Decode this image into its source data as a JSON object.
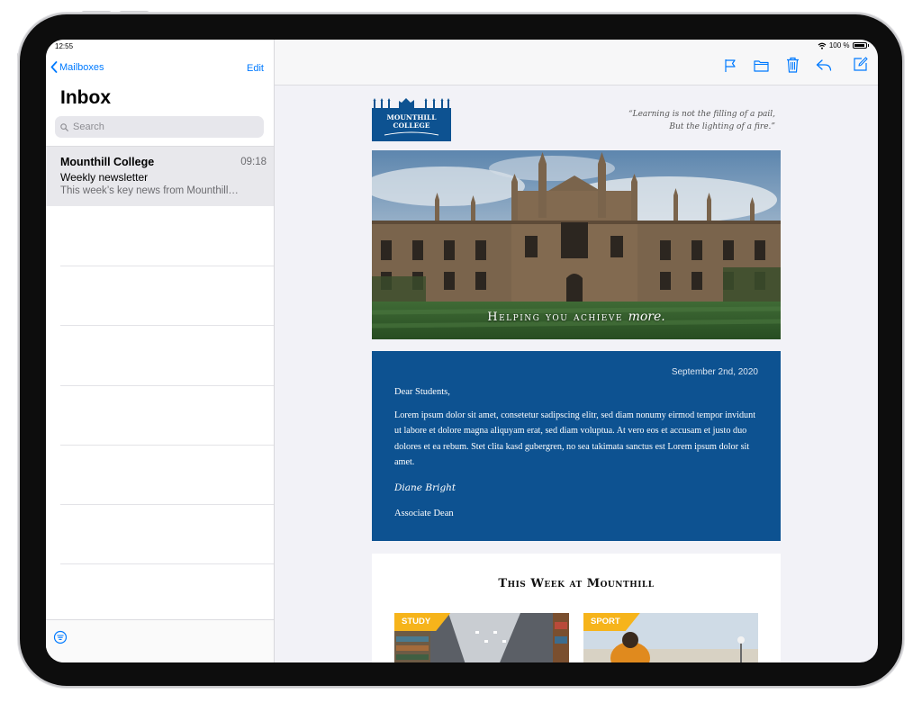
{
  "status_bar": {
    "time": "12:55",
    "battery": "100 %"
  },
  "sidebar": {
    "back_label": "Mailboxes",
    "edit_label": "Edit",
    "title": "Inbox",
    "search_placeholder": "Search",
    "messages": [
      {
        "sender": "Mounthill College",
        "time": "09:18",
        "subject": "Weekly newsletter",
        "preview": "This week’s key news from Mounthill…"
      }
    ]
  },
  "toolbar": {
    "icons": [
      "flag-icon",
      "folder-icon",
      "trash-icon",
      "reply-icon",
      "compose-icon"
    ],
    "accent": "#007aff"
  },
  "email": {
    "logo": {
      "line1": "MOUNTHILL",
      "line2": "COLLEGE"
    },
    "quote": {
      "line1": "“Learning is not the filling of a pail,",
      "line2": "But the lighting of a fire.”"
    },
    "hero": {
      "caption_main": "Helping you achieve",
      "caption_em": "more."
    },
    "letter": {
      "date": "September 2nd, 2020",
      "greeting": "Dear Students,",
      "body": "Lorem ipsum dolor sit amet, consetetur sadipscing elitr, sed diam nonumy eirmod tempor invidunt ut labore et dolore magna aliquyam erat, sed diam voluptua. At vero eos et accusam et justo duo dolores et ea rebum. Stet clita kasd gubergren, no sea takimata sanctus est Lorem ipsum dolor sit amet.",
      "signature": "Diane Bright",
      "role": "Associate Dean"
    },
    "week": {
      "title": "This Week at Mounthill",
      "cards": [
        {
          "tag": "STUDY"
        },
        {
          "tag": "SPORT"
        }
      ]
    }
  },
  "colors": {
    "brand_blue": "#0d5291",
    "tag_yellow": "#f6b41b",
    "ios_blue": "#007aff"
  }
}
